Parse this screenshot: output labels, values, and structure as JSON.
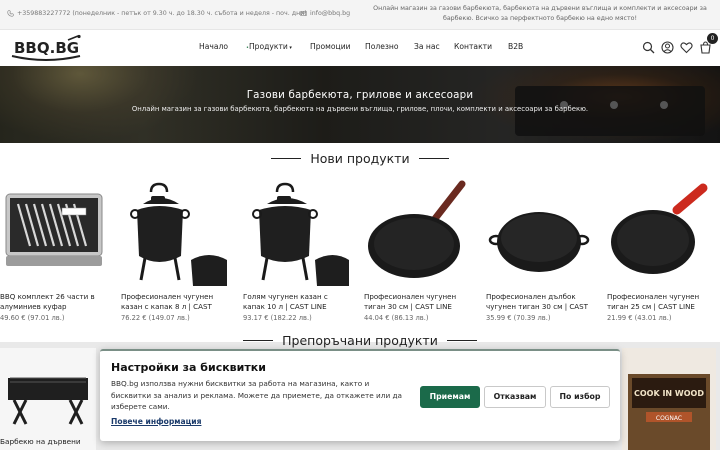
{
  "topbar": {
    "phone": "+359883227772 (понеделник - петък от 9.30 ч. до 18.30 ч. събота и неделя - поч. дни)",
    "email": "info@bbq.bg",
    "promo_line1": "Онлайн магазин за газови барбекюта, барбекюта на дървени въглища и комплекти и аксесоари за",
    "promo_line2": "барбекю. Всичко за перфектното барбекю на едно място!"
  },
  "header": {
    "logo_text": "BBQ.BG",
    "nav": [
      "Начало",
      "Продукти",
      "Промоции",
      "Полезно",
      "За нас",
      "Контакти",
      "B2B"
    ],
    "cart_count": "0"
  },
  "hero": {
    "title": "Газови барбекюта, грилове и аксесоари",
    "subtitle": "Онлайн магазин за газови барбекюта, барбекюта на дървени въглища, грилове, плочи, комплекти и аксесоари за барбекю."
  },
  "new_products": {
    "heading": "Нови продукти",
    "items": [
      {
        "name": "BBQ комплект 26 части в алуминиев куфар",
        "price": "49.60 € (97.01 лв.)"
      },
      {
        "name": "Професионален чугунен казан с капак 8 л | CAST LINE",
        "price": "76.22 € (149.07 лв.)"
      },
      {
        "name": "Голям чугунен казан с капак 10 л | CAST LINE",
        "price": "93.17 € (182.22 лв.)"
      },
      {
        "name": "Професионален чугунен тиган 30 см | CAST LINE",
        "price": "44.04 € (86.13 лв.)"
      },
      {
        "name": "Професионален дълбок чугунен тиган 30 см | CAST LINE",
        "price": "35.99 € (70.39 лв.)"
      },
      {
        "name": "Професионален чугунен тиган 25 см | CAST LINE",
        "price": "21.99 € (43.01 лв.)"
      }
    ]
  },
  "recommended": {
    "heading": "Препоръчани продукти",
    "first_label": "Барбекю на дървени",
    "box_brand": "COOK IN WOOD",
    "box_label": "COGNAC"
  },
  "cookie": {
    "title": "Настройки за бисквитки",
    "text": "BBQ.bg използва нужни бисквитки за работа на магазина, както и бисквитки за анализ и реклама. Можете да приемете, да откажете или да изберете сами.",
    "more_link": "Повече информация",
    "accept": "Приемам",
    "reject": "Отказвам",
    "choose": "По избор"
  },
  "colors": {
    "accept_button": "#1b6a4a",
    "topbar_bg": "#f4f4f4",
    "link": "#1a3a6a"
  }
}
